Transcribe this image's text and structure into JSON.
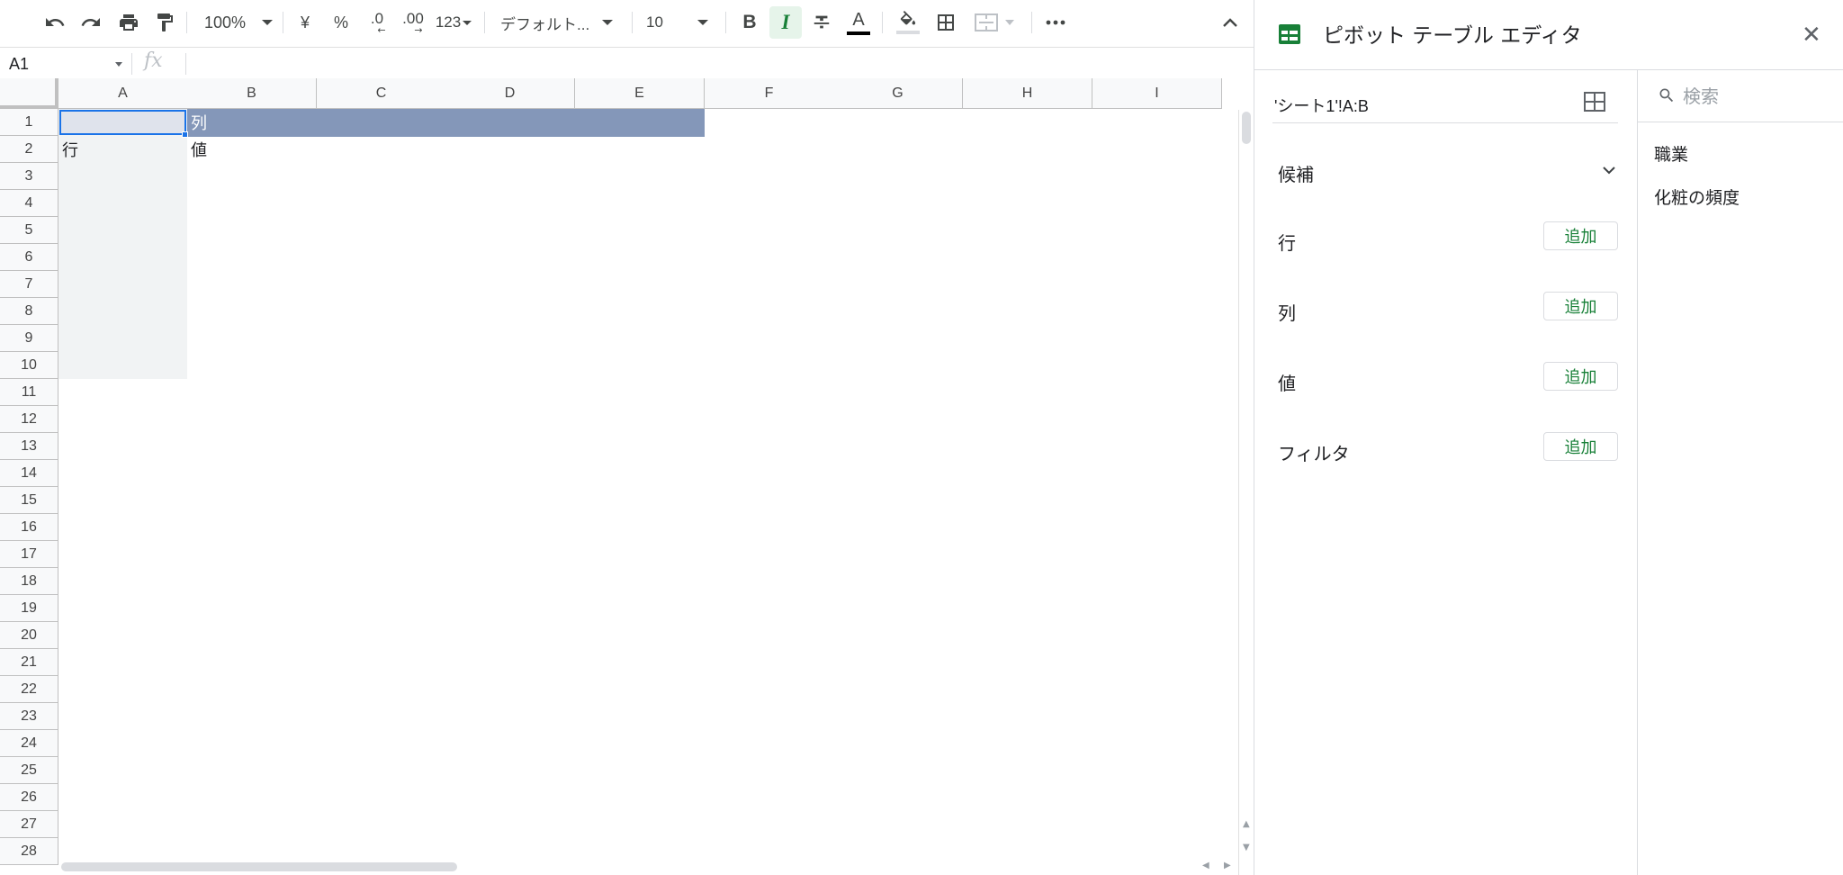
{
  "toolbar": {
    "zoom": "100%",
    "currency": "¥",
    "percent": "%",
    "decimal_decrease": ".0",
    "decimal_increase": ".00",
    "number_format": "123",
    "font": "デフォルト...",
    "font_size": "10",
    "bold": "B",
    "italic": "I",
    "text_color_letter": "A"
  },
  "formula_bar": {
    "cell_ref": "A1",
    "fx": "fx",
    "value": ""
  },
  "grid": {
    "columns": [
      "A",
      "B",
      "C",
      "D",
      "E",
      "F",
      "G",
      "H",
      "I"
    ],
    "rows": [
      "1",
      "2",
      "3",
      "4",
      "5",
      "6",
      "7",
      "8",
      "9",
      "10",
      "11",
      "12",
      "13",
      "14",
      "15",
      "16",
      "17",
      "18",
      "19",
      "20",
      "21",
      "22",
      "23",
      "24",
      "25",
      "26",
      "27",
      "28"
    ],
    "cells": {
      "B1": "列",
      "A2": "行",
      "B2": "値"
    }
  },
  "pivot_editor": {
    "title": "ピボット テーブル エディタ",
    "range": "'シート1'!A:B",
    "suggestions_label": "候補",
    "sections": [
      {
        "label": "行",
        "button": "追加"
      },
      {
        "label": "列",
        "button": "追加"
      },
      {
        "label": "値",
        "button": "追加"
      },
      {
        "label": "フィルタ",
        "button": "追加"
      }
    ],
    "search_placeholder": "検索",
    "fields": [
      "職業",
      "化粧の頻度"
    ]
  },
  "colors": {
    "accent_green": "#188038",
    "header_fill": "#8497b9",
    "selection_blue": "#1a73e8"
  }
}
